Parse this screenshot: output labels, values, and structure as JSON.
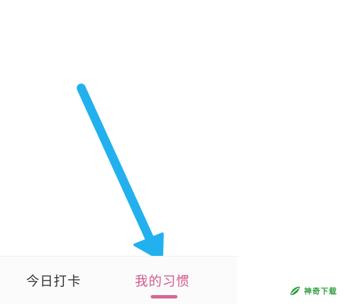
{
  "tabs": [
    {
      "label": "今日打卡",
      "active": false
    },
    {
      "label": "我的习惯",
      "active": true
    }
  ],
  "colors": {
    "active_tab": "#d15a8d",
    "inactive_tab": "#333333",
    "indicator": "#d46a95",
    "annotation_arrow": "#22b1ee",
    "watermark": "#2e9f3d"
  },
  "watermark": {
    "text": "神奇下载"
  }
}
